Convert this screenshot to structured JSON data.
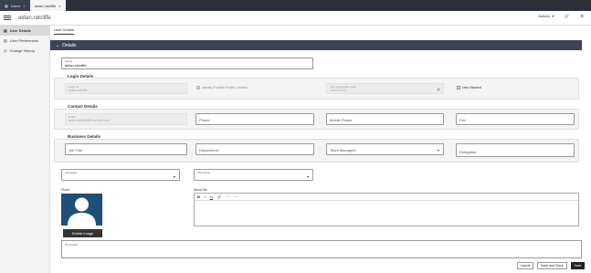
{
  "tabs": [
    {
      "label": "Users"
    },
    {
      "label": "aidan.ratcliffe"
    }
  ],
  "header": {
    "title": "aidan.ratcliffe",
    "actions_label": "Actions"
  },
  "sidebar": {
    "items": [
      {
        "label": "User Details",
        "icon": "id-card-icon"
      },
      {
        "label": "User Preferences",
        "icon": "user-list-icon"
      },
      {
        "label": "Change History",
        "icon": "clock-icon"
      }
    ]
  },
  "subtab": {
    "label": "User Details"
  },
  "section": {
    "title": "Details"
  },
  "name": {
    "label": "Name",
    "value": "aidan.ratcliffe"
  },
  "login": {
    "title": "Login Details",
    "login_id_label": "Login ID",
    "login_id_value": "aidan.ratcliffe",
    "identity_provider_label": "Identity Provider Profile Created",
    "last_login_label": "Last Successful Login",
    "last_login_value": "16/01/2023",
    "user_blocked_label": "User Blocked"
  },
  "contact": {
    "title": "Contact Details",
    "email_label": "Email",
    "email_value": "aidan.ratcliffe@example.com",
    "phone_placeholder": "Phone",
    "mobile_placeholder": "Mobile Phone",
    "fax_placeholder": "Fax"
  },
  "business": {
    "title": "Business Details",
    "job_title_placeholder": "Job Title",
    "department_placeholder": "Department",
    "team_managers_placeholder": "Team Managers",
    "delegates_placeholder": "Delegates"
  },
  "language": {
    "label": "Language"
  },
  "timezone": {
    "label": "Time Zone"
  },
  "photo": {
    "label": "Photo",
    "delete_label": "Delete Image"
  },
  "about": {
    "label": "About Me",
    "tools": [
      "B",
      "I",
      "U",
      "🔗",
      "↶",
      "↷"
    ]
  },
  "comments": {
    "label": "Comments"
  },
  "footer": {
    "cancel_label": "Cancel",
    "save_close_label": "Save and Close",
    "save_label": "Save"
  },
  "colors": {
    "tabbar": "#2a2f3a",
    "section_bar": "#3d4455",
    "photo_bg": "#1f4e7a"
  }
}
